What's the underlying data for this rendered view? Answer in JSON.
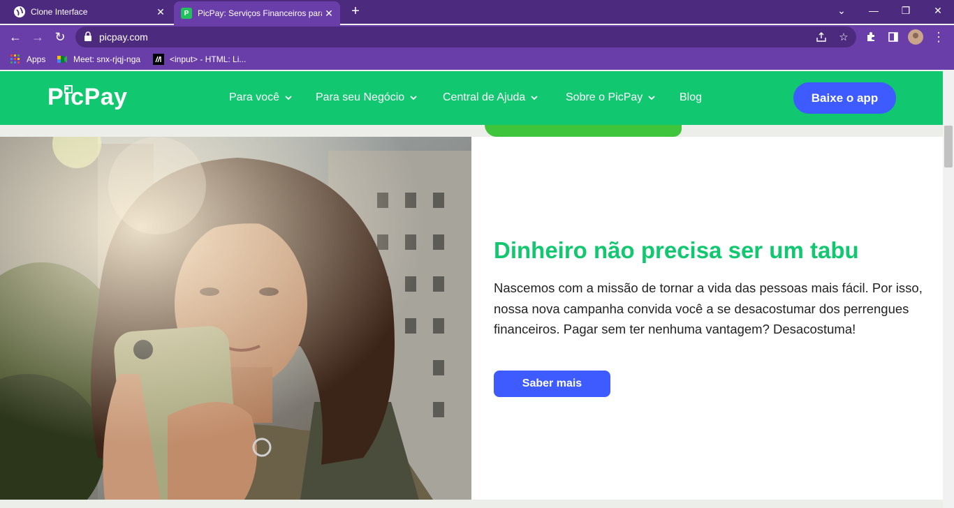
{
  "browser": {
    "tabs": [
      {
        "title": "Clone Interface",
        "favicon": "globe-icon",
        "active": false
      },
      {
        "title": "PicPay: Serviços Financeiros para",
        "favicon": "picpay-favicon",
        "active": true
      }
    ],
    "close_glyph": "✕",
    "new_tab_glyph": "+",
    "window_controls": {
      "minimize": "—",
      "restore": "❐",
      "close": "✕",
      "tab_search": "⌄"
    },
    "toolbar": {
      "back": "←",
      "forward": "→",
      "reload": "↻",
      "menu": "⋮"
    },
    "address_bar": {
      "url": "picpay.com"
    },
    "bookmarks": [
      {
        "label": "Apps",
        "icon": "apps-grid-icon"
      },
      {
        "label": "Meet: snx-rjqj-nga",
        "icon": "meet-icon"
      },
      {
        "label": "<input> - HTML: Li...",
        "icon": "mdn-icon"
      }
    ]
  },
  "site": {
    "logo": "PicPay",
    "nav": [
      {
        "label": "Para você",
        "dropdown": true
      },
      {
        "label": "Para seu Negócio",
        "dropdown": true
      },
      {
        "label": "Central de Ajuda",
        "dropdown": true
      },
      {
        "label": "Sobre o PicPay",
        "dropdown": true
      },
      {
        "label": "Blog",
        "dropdown": false
      }
    ],
    "cta": "Baixe o app",
    "colors": {
      "brand_green": "#11c76f",
      "button_blue": "#3d5bff",
      "browser_purple": "#6a3ea8"
    }
  },
  "hero": {
    "headline": "Dinheiro não precisa ser um tabu",
    "body": "Nascemos com a missão de tornar a vida das pessoas mais fácil. Por isso, nossa nova campanha convida você a se desacostumar dos perrengues financeiros. Pagar sem ter nenhuma vantagem? Desacostuma!",
    "button": "Saber mais"
  }
}
